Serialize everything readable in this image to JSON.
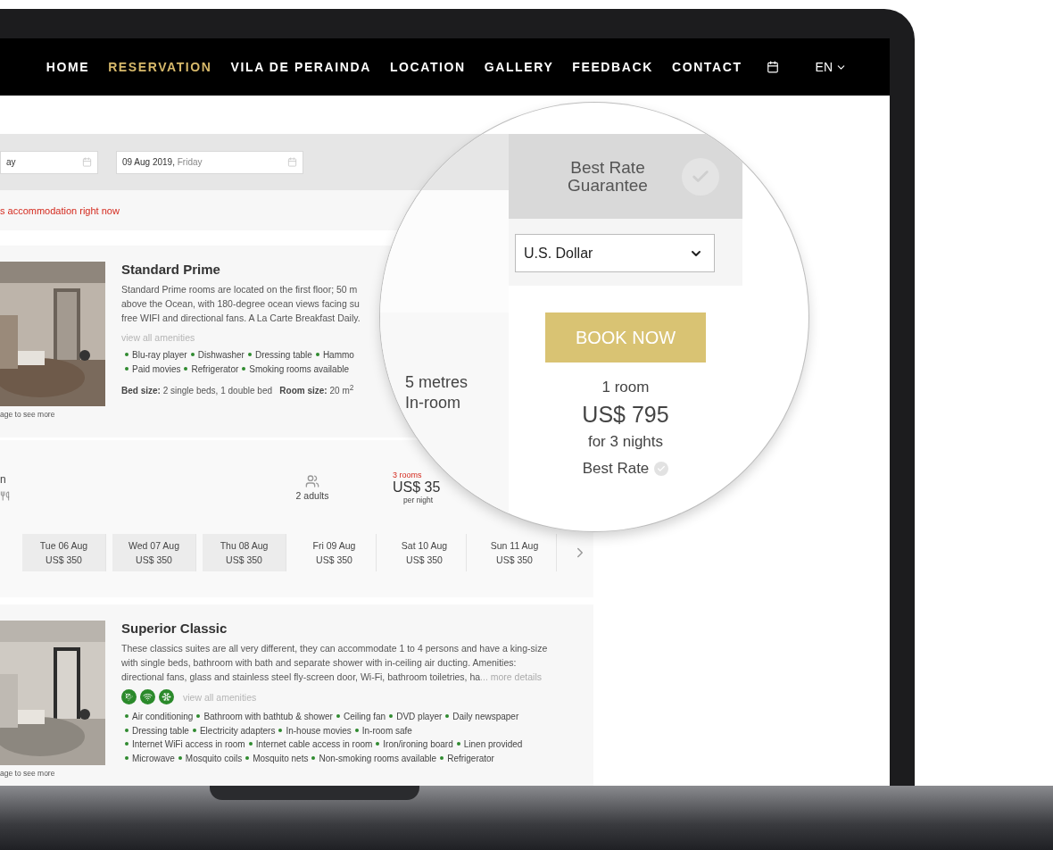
{
  "nav": {
    "items": [
      {
        "label": "HOME",
        "selected": false
      },
      {
        "label": "RESERVATION",
        "selected": true
      },
      {
        "label": "VILA DE PERAINDA",
        "selected": false
      },
      {
        "label": "LOCATION",
        "selected": false
      },
      {
        "label": "GALLERY",
        "selected": false
      },
      {
        "label": "FEEDBACK",
        "selected": false
      },
      {
        "label": "CONTACT",
        "selected": false
      }
    ],
    "language": "EN"
  },
  "search": {
    "checkin": "ay",
    "checkout_date": "09 Aug 2019,",
    "checkout_day": "Friday"
  },
  "notice": "s accommodation right now",
  "rooms": [
    {
      "title": "Standard Prime",
      "image_caption": "age to see more",
      "description": [
        "Standard Prime rooms are located on the first floor; 50 m",
        "above the Ocean, with 180-degree ocean views facing su",
        "free WIFI and directional fans. A La Carte Breakfast Daily."
      ],
      "amenities_link": "view all amenities",
      "amenity_lines": [
        [
          "Blu-ray player",
          "Dishwasher",
          "Dressing table",
          "Hammo"
        ],
        [
          "Paid movies",
          "Refrigerator",
          "Smoking rooms available"
        ]
      ],
      "bed_label": "Bed size:",
      "bed_size": "2 single beds, 1 double bed",
      "size_label": "Room size:",
      "room_size": "20 m$^{2}$"
    },
    {
      "title": "Superior Classic",
      "image_caption": "age to see more",
      "description": [
        "These classics suites are all very different, they can accommodate 1 to 4 persons and have a king-size",
        "with single beds, bathroom with bath and separate shower with in-ceiling air ducting. Amenities:",
        "directional fans, glass and stainless steel fly-screen door, Wi-Fi, bathroom toiletries, ha"
      ],
      "more_link": "... more details",
      "icons": [
        {
          "kind": "shower"
        },
        {
          "kind": "wifi"
        },
        {
          "kind": "snow"
        }
      ],
      "amenities_link": "view all amenities",
      "amenity_lines": [
        [
          "Air conditioning",
          "Bathroom with bathtub & shower",
          "Ceiling fan",
          "DVD player",
          "Daily newspaper"
        ],
        [
          "Dressing table",
          "Electricity adapters",
          "In-house movies",
          "In-room safe"
        ],
        [
          "Internet WiFi access in room",
          "Internet cable access in room",
          "Iron/ironing board",
          "Linen provided"
        ],
        [
          "Microwave",
          "Mosquito coils",
          "Mosquito nets",
          "Non-smoking rooms available",
          "Refrigerator"
        ]
      ]
    }
  ],
  "rate": {
    "plan": "n",
    "guests": "2 adults",
    "rooms_left": "3 rooms",
    "price": "US$ 35",
    "per": "per night",
    "days": [
      {
        "day": "Tue 06 Aug",
        "price": "US$ 350",
        "selected": true
      },
      {
        "day": "Wed 07 Aug",
        "price": "US$ 350",
        "selected": true
      },
      {
        "day": "Thu 08 Aug",
        "price": "US$ 350",
        "selected": true
      },
      {
        "day": "Fri 09 Aug",
        "price": "US$ 350",
        "selected": false
      },
      {
        "day": "Sat 10 Aug",
        "price": "US$ 350",
        "selected": false
      },
      {
        "day": "Sun 11 Aug",
        "price": "US$ 350",
        "selected": false
      }
    ]
  },
  "lens": {
    "guarantee": "Best Rate Guarantee",
    "currency": "U.S. Dollar",
    "book": "BOOK NOW",
    "fragments": [
      "5 metres",
      "In-room"
    ],
    "rooms": "1 room",
    "total": "US$ 795",
    "nights": "for 3 nights",
    "best_rate": "Best Rate"
  }
}
